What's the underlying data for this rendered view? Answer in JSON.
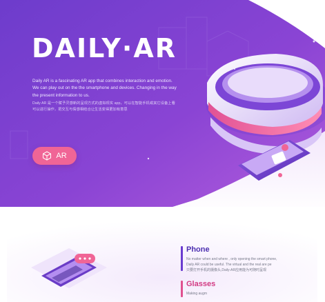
{
  "hero": {
    "title": "DAILY·AR",
    "description_en": "Daily AR is a fascinating AR app that combines interaction and emotion. We can play out on the the smartphone and devices. Changing in the way the present information to us.",
    "description_cn": "Daily AR 是一个赋予灵感新的呈现方式的虚拟现实 app，可以在智能手机或其它设备上看可以进行操作，把交互与情感相结合让生活变得更加有意思",
    "ar_button_label": "AR",
    "ar_icon": "ar-cube-icon"
  },
  "features": [
    {
      "title": "Phone",
      "text_line1": "No matter when and where , only opening the smart phone,",
      "text_line2": "Daily AR could be useful. The virtual and the real are pe",
      "text_cn": "只要打开手机的摄像头,Daily-AR应用能为可随时呈现"
    },
    {
      "title": "Glasses",
      "text_line1": "Making augm"
    }
  ],
  "colors": {
    "hero_top": "#7b3fd3",
    "hero_bottom": "#a14fd8",
    "accent_pink": "#f06596",
    "feature_purple": "#4c2fb0",
    "feature_pink": "#d23b83"
  }
}
